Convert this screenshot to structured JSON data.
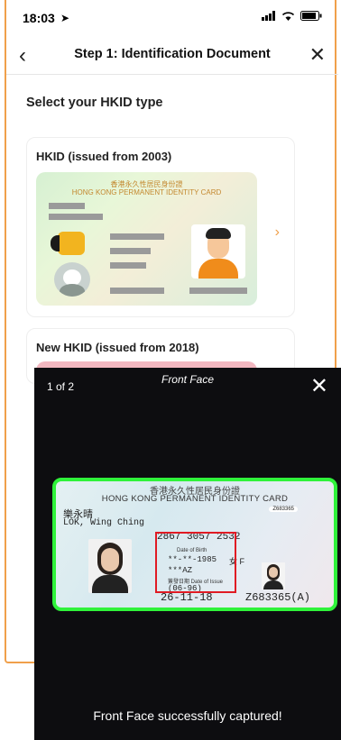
{
  "status_bar": {
    "time": "18:03"
  },
  "header": {
    "title": "Step 1: Identification Document"
  },
  "main": {
    "subtitle": "Select your HKID type",
    "cards": [
      {
        "title": "HKID (issued from 2003)",
        "card_heading_cn": "香港永久性居民身份證",
        "card_heading_en": "HONG KONG PERMANENT IDENTITY CARD"
      },
      {
        "title": "New HKID (issued from 2018)"
      }
    ]
  },
  "overlay": {
    "counter": "1 of 2",
    "face_label": "Front Face",
    "caption": "Front Face successfully captured!",
    "id_card": {
      "heading_cn": "香港永久性居民身份證",
      "heading_en": "HONG KONG PERMANENT IDENTITY CARD",
      "name_cn": "樂永晴",
      "name_en": "LOK, Wing Ching",
      "ccc": "2867 3057 2532",
      "dob_label": "Date of Birth",
      "dob": "**-**-1985",
      "sex": "女 F",
      "symbols": "***AZ",
      "issue_label": "簽發日期 Date of Issue",
      "issue_code": "(06-96)",
      "issue_date": "26-11-18",
      "id_no": "Z683365(A)",
      "small_no": "Z683365"
    }
  },
  "colors": {
    "accent": "#f0a04b",
    "capture_frame": "#2ff23a",
    "highlight": "#e01b24"
  }
}
